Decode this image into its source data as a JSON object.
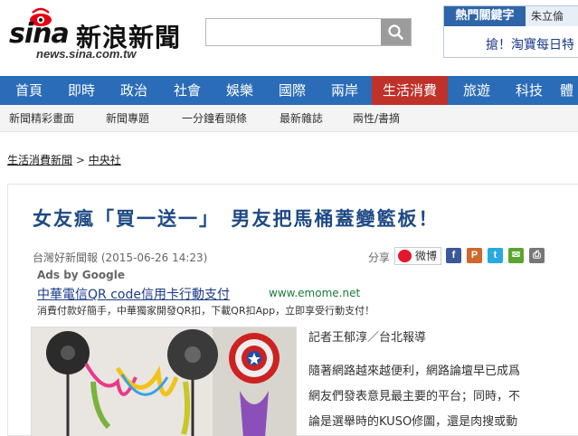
{
  "brand": {
    "logo_word": "sina",
    "logo_chinese": "新浪新聞",
    "url": "news.sina.com.tw"
  },
  "search": {
    "value": "",
    "placeholder": ""
  },
  "hot": {
    "title": "熱門關鍵字",
    "tab2": "朱立倫",
    "link": "搶！淘寶每日特"
  },
  "nav": [
    {
      "label": "首頁"
    },
    {
      "label": "即時"
    },
    {
      "label": "政治"
    },
    {
      "label": "社會"
    },
    {
      "label": "娛樂"
    },
    {
      "label": "國際"
    },
    {
      "label": "兩岸"
    },
    {
      "label": "生活消費",
      "active": true
    },
    {
      "label": "旅遊"
    },
    {
      "label": "科技"
    },
    {
      "label": "體"
    }
  ],
  "subnav": [
    {
      "label": "新聞精彩畫面"
    },
    {
      "label": "新聞專題"
    },
    {
      "label": "一分鐘看頭條"
    },
    {
      "label": "最新雜誌"
    },
    {
      "label": "兩性/書摘"
    }
  ],
  "breadcrumb": {
    "section": "生活消費新聞",
    "separator": " > ",
    "source": "中央社"
  },
  "article": {
    "title": "女友瘋「買一送一」　男友把馬桶蓋變籃板！",
    "source": "台灣好新聞報",
    "datetime": "(2015-06-26 14:23)",
    "share_label": "分享",
    "weibo_label": "微博",
    "byline": "記者王郁淳／台北報導",
    "paragraph_lines": [
      "隨著網路越來越便利，網路論壇早已成爲",
      "網友們發表意見最主要的平台；同時，不",
      "論是選舉時的KUSO修圖，還是肉搜或動"
    ]
  },
  "ad": {
    "label": "Ads by Google",
    "title": "中華電信QR code信用卡行動支付",
    "url": "www.emome.net",
    "description": "消費付款好簡手，中華獨家開發QR扣，下載QR扣App，立即享受行動支付！"
  },
  "share_icons": [
    {
      "name": "facebook-icon",
      "glyph": "f",
      "color": "#3b5998"
    },
    {
      "name": "plurk-icon",
      "glyph": "P",
      "color": "#cf682f"
    },
    {
      "name": "twitter-icon",
      "glyph": "t",
      "color": "#29a9e0"
    },
    {
      "name": "email-icon",
      "glyph": "✉",
      "color": "#5aa52f"
    },
    {
      "name": "print-icon",
      "glyph": "⎙",
      "color": "#777777"
    }
  ],
  "colors": {
    "nav_bg": "#2a6cb7",
    "nav_active": "#c0312a",
    "title": "#1e4a85",
    "link": "#1a3a88",
    "ad_url": "#1a7a3a"
  }
}
